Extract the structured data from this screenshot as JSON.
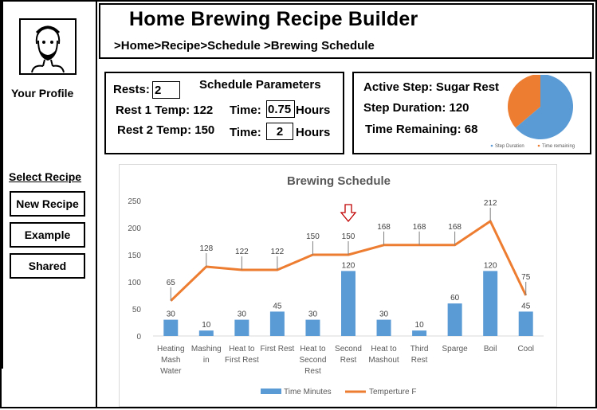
{
  "sidebar": {
    "profile_label": "Your Profile",
    "select_recipe_label": "Select Recipe",
    "buttons": [
      "New Recipe",
      "Example",
      "Shared"
    ]
  },
  "header": {
    "title": "Home Brewing Recipe Builder",
    "breadcrumb": [
      ">Home",
      ">Recipe",
      ">",
      "Schedule",
      " >",
      "Brewing Schedule"
    ]
  },
  "params": {
    "title": "Schedule Parameters",
    "rests_label": "Rests:",
    "rests_value": "2",
    "rest1_label": "Rest 1 Temp: 122",
    "rest2_label": "Rest 2 Temp: 150",
    "time_label": "Time:",
    "time1_value": "0.75",
    "time2_value": "2",
    "hours_label": "Hours"
  },
  "active": {
    "step": "Active Step: Sugar Rest",
    "duration": "Step Duration: 120",
    "remaining": "Time Remaining: 68",
    "pie_legend": [
      "Step Duration",
      "Time remaining"
    ],
    "pie_values": [
      120,
      68
    ],
    "pie_colors": [
      "#5b9bd5",
      "#ed7d31"
    ]
  },
  "chart_data": {
    "type": "bar",
    "title": "Brewing Schedule",
    "categories": [
      "Heating Mash Water",
      "Mashing in",
      "Heat to First Rest",
      "First Rest",
      "Heat to Second Rest",
      "Second Rest",
      "Heat to Mashout",
      "Third Rest",
      "Sparge",
      "Boil",
      "Cool"
    ],
    "category_lines": [
      [
        "Heating",
        "Mash",
        "Water"
      ],
      [
        "Mashing",
        "in"
      ],
      [
        "Heat to",
        "First Rest"
      ],
      [
        "First Rest"
      ],
      [
        "Heat to",
        "Second",
        "Rest"
      ],
      [
        "Second",
        "Rest"
      ],
      [
        "Heat to",
        "Mashout"
      ],
      [
        "Third",
        "Rest"
      ],
      [
        "Sparge"
      ],
      [
        "Boil"
      ],
      [
        "Cool"
      ]
    ],
    "series": [
      {
        "name": "Time Minutes",
        "type": "bar",
        "color": "#5b9bd5",
        "values": [
          30,
          10,
          30,
          45,
          30,
          120,
          30,
          10,
          60,
          120,
          45
        ]
      },
      {
        "name": "Temperture F",
        "type": "line",
        "color": "#ed7d31",
        "values": [
          65,
          128,
          122,
          122,
          150,
          150,
          168,
          168,
          168,
          212,
          75
        ]
      }
    ],
    "ylim": [
      0,
      250
    ],
    "yticks": [
      0,
      50,
      100,
      150,
      200,
      250
    ],
    "grid": false,
    "legend": "bottom",
    "current_step_marker": "Second Rest",
    "xlabel": "",
    "ylabel": ""
  }
}
